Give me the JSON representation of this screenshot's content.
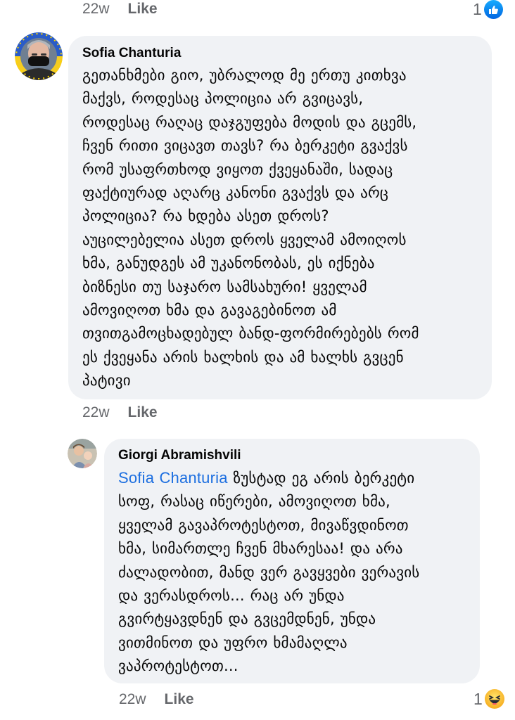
{
  "top": {
    "time": "22w",
    "like_label": "Like",
    "reaction_count": "1",
    "reaction_icon": "like-icon"
  },
  "comment1": {
    "author": "Sofia Chanturia",
    "avatar_icon": "profile-photo-ukraine-frame",
    "text_lines": [
      "გეთანხმები გიო, უბრალოდ მე ერთუ კითხვა",
      "მაქვს, როდესაც პოლიცია არ გვიცავს,",
      "როდესაც რაღაც დაჯგუფება მოდის და გცემს,",
      "ჩვენ რითი ვიცავთ თავს? რა ბერკეტი გვაქვს",
      "რომ უსაფრთხოდ ვიყოთ ქვეყანაში, სადაც",
      "ფაქტიურად აღარც კანონი გვაქვს და არც",
      "პოლიცია? რა ხდება ასეთ დროს?",
      "აუცილებელია ასეთ დროს ყველამ ამოიღოს",
      "ხმა, განუდგეს ამ უკანონობას, ეს იქნება",
      "ბიზნესი თუ საჯარო სამსახური! ყველამ",
      "ამოვიღოთ ხმა და გავაგებინოთ ამ",
      "თვითგამოცხადებულ ბანდ-ფორმირებებს რომ",
      "ეს ქვეყანა არის ხალხის და ამ ხალხს გვცენ",
      "პატივი"
    ],
    "time": "22w",
    "like_label": "Like"
  },
  "comment2": {
    "author": "Giorgi Abramishvili",
    "avatar_icon": "profile-photo-child",
    "mention": "Sofia Chanturia",
    "first_line_rest": " ზუსტად ეგ არის ბერკეტი",
    "text_lines": [
      "სოფ, რასაც იწერები, ამოვიღოთ ხმა,",
      "ყველამ გავაპროტესტოთ, მივაწვდინოთ",
      "ხმა, სიმართლე ჩვენ მხარესაა! და არა",
      "ძალადობით, მანდ ვერ გავყვები ვერავის",
      "და ვერასდროს... რაც არ უნდა",
      "გვირტყავდნენ და გვცემდნენ, უნდა",
      "ვითმინოთ და უფრო ხმამაღლა",
      "ვაპროტესტოთ..."
    ],
    "time": "22w",
    "like_label": "Like",
    "reaction_count": "1",
    "reaction_icon": "haha-icon"
  },
  "colors": {
    "bubble": "#f0f2f5",
    "meta_text": "#65676b",
    "mention": "#1d6fe0",
    "like_blue": "#0866ff"
  }
}
